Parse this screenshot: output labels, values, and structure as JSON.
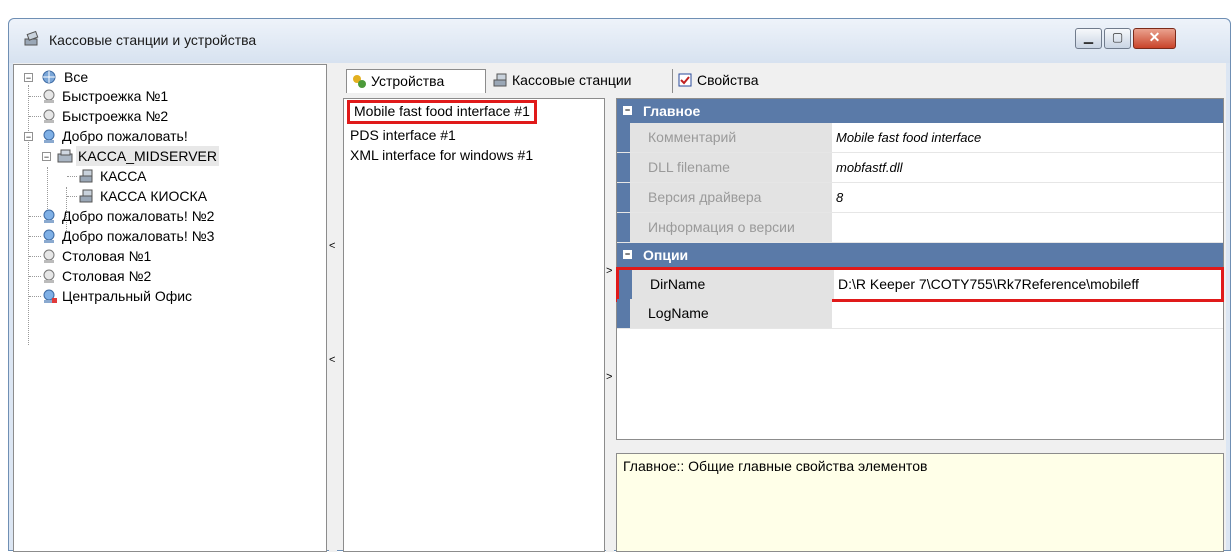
{
  "window": {
    "title": "Кассовые станции и устройства",
    "buttons": {
      "minimize": "▁",
      "maximize": "▢",
      "close": "✕"
    }
  },
  "tree": {
    "items": [
      {
        "label": "Все",
        "icon": "globe-icon"
      },
      {
        "label": "Быстроежка №1",
        "icon": "station-icon"
      },
      {
        "label": "Быстроежка №2",
        "icon": "station-icon"
      },
      {
        "label": "Добро пожаловать!",
        "icon": "station-blue-icon"
      },
      {
        "label": "KACCA_MIDSERVER",
        "icon": "server-icon"
      },
      {
        "label": "КАССА",
        "icon": "cash-register-icon"
      },
      {
        "label": "КАССА КИОСКА",
        "icon": "cash-register-icon"
      },
      {
        "label": "Добро пожаловать! №2",
        "icon": "station-blue-icon"
      },
      {
        "label": "Добро пожаловать! №3",
        "icon": "station-blue-icon"
      },
      {
        "label": "Столовая №1",
        "icon": "station-icon"
      },
      {
        "label": "Столовая №2",
        "icon": "station-icon"
      },
      {
        "label": "Центральный Офис",
        "icon": "office-icon"
      }
    ]
  },
  "tabs": [
    {
      "label": "Устройства",
      "icon": "devices-icon",
      "active": true
    },
    {
      "label": "Кассовые станции",
      "icon": "cash-register-icon",
      "active": false
    },
    {
      "label": "Свойства",
      "icon": "properties-icon",
      "active": false
    }
  ],
  "devices": [
    "Mobile fast food interface #1",
    "PDS interface #1",
    "XML interface for windows #1"
  ],
  "properties": {
    "main_category": "Главное",
    "main_rows": [
      {
        "name": "Комментарий",
        "value": "Mobile fast food interface"
      },
      {
        "name": "DLL filename",
        "value": "mobfastf.dll"
      },
      {
        "name": "Версия драйвера",
        "value": "8"
      },
      {
        "name": "Информация о версии",
        "value": ""
      }
    ],
    "options_category": "Опции",
    "options_rows": [
      {
        "name": "DirName",
        "value": "D:\\R Keeper 7\\COTY755\\Rk7Reference\\mobileff"
      },
      {
        "name": "LogName",
        "value": ""
      }
    ]
  },
  "description": "Главное:: Общие главные свойства элементов",
  "colors": {
    "accent": "#5a7aa8",
    "highlight": "#e01a1a",
    "desc_bg": "#ffffe8"
  }
}
